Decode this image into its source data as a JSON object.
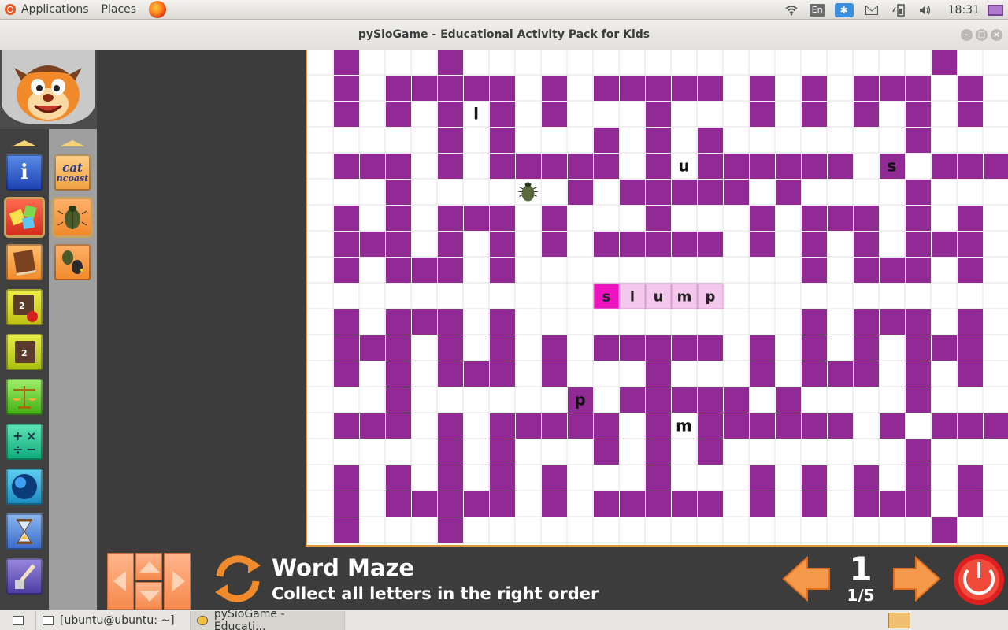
{
  "top_panel": {
    "menus": [
      "Applications",
      "Places"
    ],
    "language": "En",
    "clock": "18:31"
  },
  "window": {
    "title": "pySioGame - Educational Activity Pack for Kids"
  },
  "sidebar": {
    "category_icons": [
      "info-icon",
      "abc-icon",
      "book-icon",
      "numbers-apple-icon",
      "numbers-icon",
      "scales-icon",
      "math-operations-icon",
      "sphere-icon",
      "hourglass-icon",
      "paint-icon"
    ],
    "activity_icons": [
      {
        "name": "word-game-icon",
        "text": "cat"
      },
      {
        "name": "word-maze-beetle-icon"
      },
      {
        "name": "beetles-icon"
      }
    ]
  },
  "game": {
    "title": "Word Maze",
    "subtitle": "Collect all letters in the right order",
    "level": "1",
    "progress": "1/5",
    "word_letters": [
      "s",
      "l",
      "u",
      "m",
      "p"
    ],
    "collected_count": 1,
    "maze": {
      "wall_color": "#912a94",
      "grid_color": "#e2e2e2",
      "rows": [
        ".#...#..................#...#",
        ".#.#####.#.#####.#.#.###.#.#",
        ".#.#.#.#.#...#...#.#.#.#.#.#",
        ".....#.#...#.#.#.......#....",
        ".###.#.#####.#.######.#.###",
        "...#......#.#####.#....#...",
        ".#.#.###.#...#...#.###.#.#",
        ".###.#.#.#.#####.#.#.#.###",
        ".#.###.#...........#.###.#",
        "............................",
        ".#.###.#...........#.###.#",
        ".###.#.#.#.#####.#.#.#.###",
        ".#.#.###.#...#...#.###.#.#",
        "...#......#.#####.#....#...",
        ".###.#.#####.#.######.#.###",
        ".....#.#...#.#.#.......#....",
        ".#.#.#.#.#...#...#.#.#.#.#.#",
        ".#.#####.#.#####.#.#.###.#.#",
        ".#...#..................#...#"
      ],
      "scattered_letters": [
        {
          "char": "l",
          "col": 6,
          "row": 2
        },
        {
          "char": "u",
          "col": 14,
          "row": 4
        },
        {
          "char": "s",
          "col": 22,
          "row": 4
        },
        {
          "char": "p",
          "col": 10,
          "row": 13
        },
        {
          "char": "m",
          "col": 14,
          "row": 14
        }
      ],
      "player": {
        "col": 8,
        "row": 5,
        "icon": "beetle-icon"
      },
      "word_start": {
        "col": 11,
        "row": 9
      }
    }
  },
  "taskbar": {
    "items": [
      "[ubuntu@ubuntu: ~]",
      "pySioGame - Educati..."
    ]
  }
}
